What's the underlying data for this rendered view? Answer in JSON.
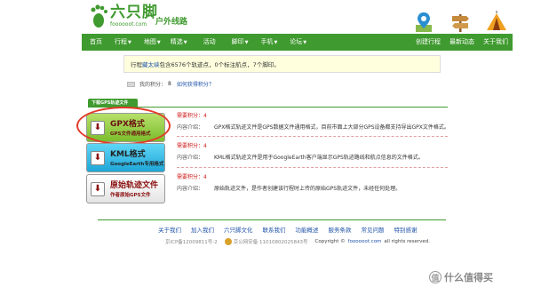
{
  "header": {
    "logo_cn": "六只脚",
    "logo_domain": "foooooot.com",
    "logo_sub": "户外线路"
  },
  "nav": {
    "items": [
      {
        "label": "首页",
        "dropdown": false
      },
      {
        "label": "行程",
        "dropdown": true
      },
      {
        "label": "地图",
        "dropdown": true
      },
      {
        "label": "精选",
        "dropdown": true
      },
      {
        "label": "活动",
        "dropdown": false
      },
      {
        "label": "脚印",
        "dropdown": true
      },
      {
        "label": "手机",
        "dropdown": true
      },
      {
        "label": "论坛",
        "dropdown": true
      }
    ],
    "right_items": [
      {
        "label": "创建行程"
      },
      {
        "label": "最新动态"
      },
      {
        "label": "关于我们"
      }
    ],
    "arrow": "▼"
  },
  "info": {
    "prefix": "行程",
    "trip_name": "藏太峡",
    "suffix": "包含6576个轨迹点，0个标注航点，7个脚印。"
  },
  "help": {
    "label": "我的积分：",
    "value": "8",
    "link": "如何获得积分？"
  },
  "download": {
    "tab_label": "下载GPS轨迹文件",
    "buttons": [
      {
        "title": "GPX格式",
        "desc": "GPS文件通用格式",
        "need": "需要积分：4",
        "content_label": "内容介绍：",
        "content": "GPX格式轨迹文件是GPS数据文件通用格式，目前市面上大部分GPS设备都支持导出GPX文件格式。"
      },
      {
        "title": "KML格式",
        "desc": "GoogleEarth专用格式",
        "need": "需要积分：4",
        "content_label": "内容介绍：",
        "content": "KML格式轨迹文件是用于GoogleEarth客户端显示GPS轨迹路线和航点信息的文件格式。"
      },
      {
        "title": "原始轨迹文件",
        "desc": "作者原始GPS文件",
        "need": "需要积分：4",
        "content_label": "内容介绍：",
        "content": "原始轨迹文件，是作者创建该行程时上传的原始GPS轨迹文件，未经任何处理。"
      }
    ],
    "arrow_glyph": "⬇"
  },
  "footer": {
    "links": [
      "关于我们",
      "加入我们",
      "六只脚文化",
      "联系我们",
      "功能概述",
      "服务条款",
      "常见问题",
      "特别感谢"
    ],
    "icp": "京ICP备12009811号-2",
    "police": "京公网安备 11010802025843号",
    "copyright_prefix": "Copyright ©",
    "copyright_domain": "foooooot.com",
    "copyright_suffix": "all rights reserved."
  },
  "watermark": {
    "glyph": "值",
    "text": "什么值得买"
  },
  "colors": {
    "brand_green": "#3f9a2f",
    "highlight_red": "#e23a2a",
    "link_blue": "#2255aa",
    "info_bg": "#ffffdd"
  }
}
